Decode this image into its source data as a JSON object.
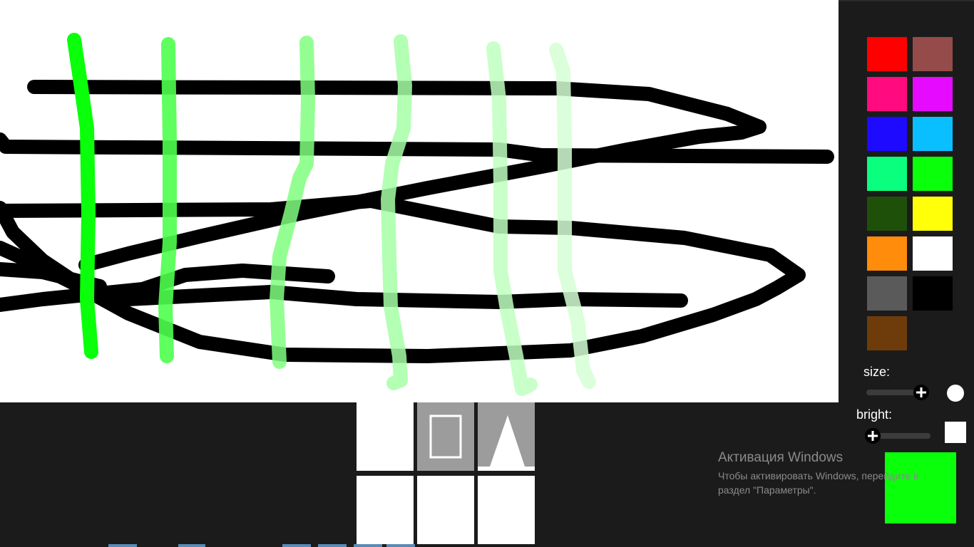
{
  "palette": {
    "colors": [
      {
        "name": "red",
        "hex": "#ff0000"
      },
      {
        "name": "rosy-brown",
        "hex": "#964b4b"
      },
      {
        "name": "pink",
        "hex": "#ff0a7f"
      },
      {
        "name": "magenta",
        "hex": "#e60aff"
      },
      {
        "name": "blue",
        "hex": "#1e0aff"
      },
      {
        "name": "sky-blue",
        "hex": "#0abfff"
      },
      {
        "name": "spring-green",
        "hex": "#0aff7f"
      },
      {
        "name": "green",
        "hex": "#0aff0a"
      },
      {
        "name": "dark-green",
        "hex": "#1e500a"
      },
      {
        "name": "yellow",
        "hex": "#ffff0a"
      },
      {
        "name": "orange",
        "hex": "#ff8c0a"
      },
      {
        "name": "white",
        "hex": "#ffffff"
      },
      {
        "name": "gray",
        "hex": "#5a5a5a"
      },
      {
        "name": "black",
        "hex": "#000000"
      },
      {
        "name": "brown",
        "hex": "#6e3c0a"
      }
    ]
  },
  "controls": {
    "size_label": "size:",
    "bright_label": "bright:",
    "size_value": 0.9,
    "bright_value": 0.05,
    "thumb_icon": "plus-icon"
  },
  "current_color": "#0aff0a",
  "tools": [
    {
      "name": "blank-tool",
      "icon": "none",
      "active": false
    },
    {
      "name": "rectangle-tool",
      "icon": "rectangle-outline-icon",
      "active": true
    },
    {
      "name": "triangle-tool",
      "icon": "triangle-icon",
      "active": true
    },
    {
      "name": "blank-tool",
      "icon": "none",
      "active": false
    },
    {
      "name": "blank-tool",
      "icon": "none",
      "active": false
    },
    {
      "name": "blank-tool",
      "icon": "none",
      "active": false
    }
  ],
  "watermark": {
    "title": "Активация Windows",
    "line1": "Чтобы активировать Windows, перейдите в",
    "line2": "раздел \"Параметры\"."
  },
  "drawing": {
    "stroke_colors": {
      "black": "#000000",
      "green1": "#0aff0a",
      "green2": "#4dff4d",
      "green3": "#80ff80",
      "green4": "#a6ffa6",
      "green5": "#bfffbf",
      "green6": "#d4ffd4"
    }
  }
}
